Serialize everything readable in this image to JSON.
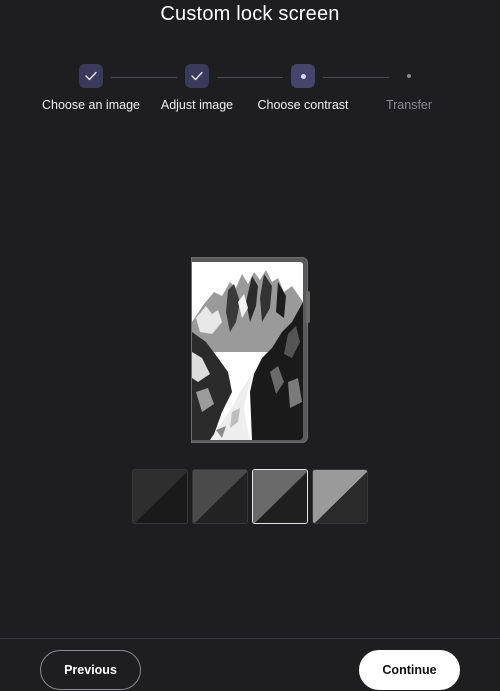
{
  "title": "Custom lock screen",
  "steps": [
    {
      "label": "Choose an image",
      "state": "done"
    },
    {
      "label": "Adjust image",
      "state": "done"
    },
    {
      "label": "Choose contrast",
      "state": "current"
    },
    {
      "label": "Transfer",
      "state": "pending"
    }
  ],
  "preview": {
    "image": "mountain landscape with trail (black and white)"
  },
  "contrast_options": [
    {
      "option": "contrast-1",
      "colors": [
        "#2e2e2e",
        "#1a1a1a"
      ]
    },
    {
      "option": "contrast-2",
      "colors": [
        "#4a4a4a",
        "#222222"
      ]
    },
    {
      "option": "contrast-3",
      "colors": [
        "#6a6a6a",
        "#1f1f1f"
      ],
      "selected": true
    },
    {
      "option": "contrast-4",
      "colors": [
        "#9a9a9a",
        "#2a2a2a"
      ]
    }
  ],
  "footer": {
    "previous_label": "Previous",
    "continue_label": "Continue"
  }
}
